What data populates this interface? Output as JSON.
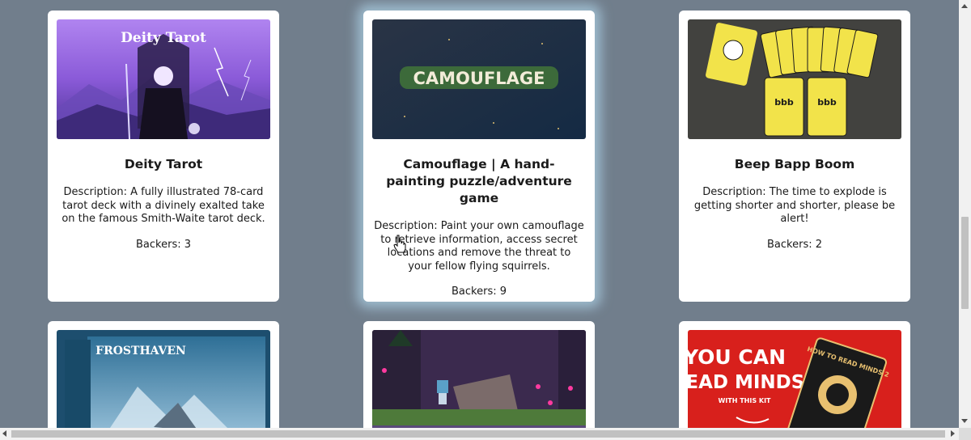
{
  "cards": [
    {
      "title": "Deity Tarot",
      "description": "Description: A fully illustrated 78-card tarot deck with a divinely exalted take on the famous Smith-Waite tarot deck.",
      "backers": "Backers: 3",
      "image_text": "Deity Tarot"
    },
    {
      "title": "Camouflage | A hand-painting puzzle/adventure game",
      "description": "Description: Paint your own camouflage to retrieve information, access secret locations and remove the threat to your fellow flying squirrels.",
      "backers": "Backers: 9",
      "image_text": "CAMOUFLAGE"
    },
    {
      "title": "Beep Bapp Boom",
      "description": "Description: The time to explode is getting shorter and shorter, please be alert!",
      "backers": "Backers: 2",
      "image_text": "bbb"
    },
    {
      "image_text": "FROSTHAVEN"
    },
    {
      "image_text": ""
    },
    {
      "image_text_line1": "YOU CAN",
      "image_text_line2": "READ MINDS",
      "image_text_line3": "WITH THIS KIT",
      "image_text_book": "HOW TO READ MINDS 2"
    }
  ],
  "colors": {
    "page_background": "#717e8c",
    "card_background": "#ffffff",
    "hover_glow": "#aacde1"
  }
}
